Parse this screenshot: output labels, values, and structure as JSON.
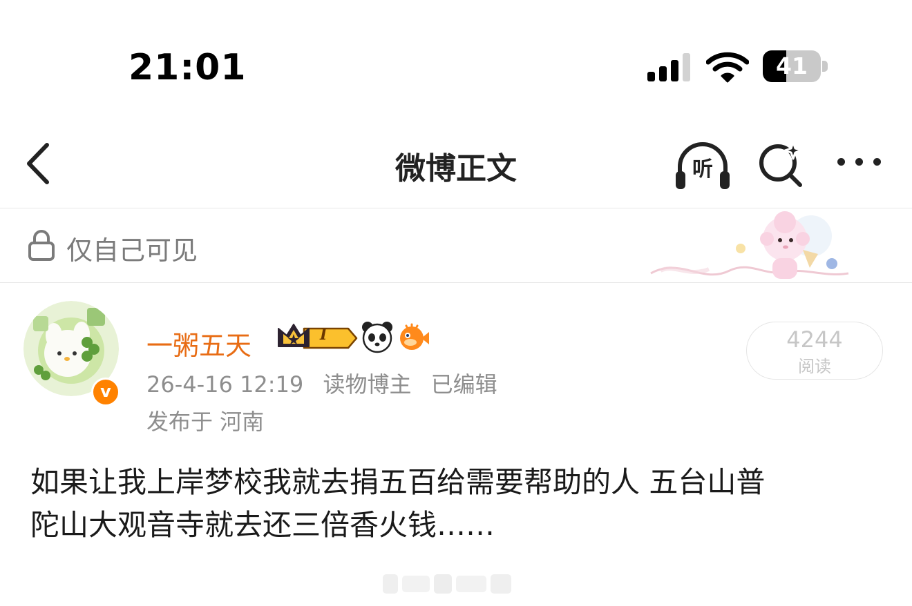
{
  "status_bar": {
    "time": "21:01",
    "battery": "41",
    "battery_level": 0.41
  },
  "nav": {
    "title": "微博正文",
    "listen_label": "听"
  },
  "visibility": {
    "text": "仅自己可见"
  },
  "post": {
    "author": {
      "name": "一粥五天",
      "level": "I"
    },
    "date": "26-4-16 12:19",
    "author_tag": "读物博主",
    "edited": "已编辑",
    "location": "发布于 河南",
    "reads": {
      "count": "4244",
      "label": "阅读"
    },
    "lines": [
      "如果让我上岸梦校我就去捐五百给需要帮助的人 五台山普",
      "陀山大观音寺就去还三倍香火钱……"
    ]
  },
  "colors": {
    "username": "#e86c14",
    "verified": "#ff8200",
    "meta": "#8e8e8e"
  }
}
